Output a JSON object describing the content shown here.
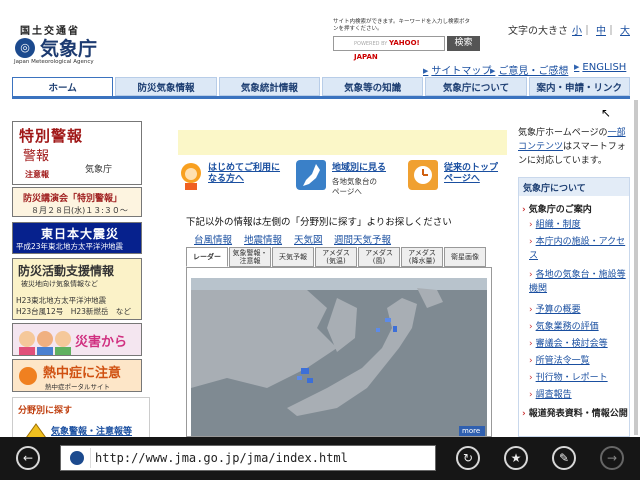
{
  "header": {
    "ministry": "国土交通省",
    "logo_text": "気象庁",
    "logo_en": "Japan Meteorological Agency",
    "search_help": "サイト内検索ができます。キーワードを入力し検索ボタンを押すください。",
    "search_powered": "POWERED BY",
    "search_brand": "YAHOO! JAPAN",
    "search_button": "検索",
    "font_size_label": "文字の大きさ",
    "font_small": "小",
    "font_medium": "中",
    "font_large": "大",
    "util_links": [
      "サイトマップ",
      "ご意見・ご感想",
      "ENGLISH"
    ]
  },
  "nav": [
    "ホーム",
    "防災気象情報",
    "気象統計情報",
    "気象等の知識",
    "気象庁について",
    "案内・申請・リンク"
  ],
  "left_banners": {
    "tokubetsu": {
      "t1": "特別警報",
      "t2": "警報",
      "t3": "注意報",
      "jma": "気象庁"
    },
    "lecture": {
      "t1": "防災講演会「特別警報」",
      "t2": "８月２８日(水)１３:３０～"
    },
    "quake": {
      "t1": "東日本大震災",
      "t2": "平成23年東北地方太平洋沖地震"
    },
    "support": {
      "t1": "防災活動支援情報",
      "t2": "被災地向け気象情報など",
      "t3": "H23東北地方太平洋沖地震",
      "t4": "H23台風12号　H23新燃岳　など"
    },
    "kids": {
      "t1": "災害から"
    },
    "heat": {
      "t1": "熱中症に注意",
      "t2": "熱中症ポータルサイト"
    }
  },
  "bunya": {
    "heading": "分野別に探す",
    "link": "気象警報・注意報等"
  },
  "quick_links": [
    {
      "title1": "はじめてご利用に",
      "title2": "なる方へ",
      "sub1": "",
      "sub2": ""
    },
    {
      "title1": "地域別に見る",
      "title2": "",
      "sub1": "各地気象台の",
      "sub2": "ページへ"
    },
    {
      "title1": "従来のトップ",
      "title2": "ページへ",
      "sub1": "",
      "sub2": ""
    }
  ],
  "intro": "下記以外の情報は左側の「分野別に探す」よりお探しください",
  "sub_links": [
    "台風情報",
    "地震情報",
    "天気図",
    "週間天気予報"
  ],
  "map_tabs": [
    {
      "l1": "レーダー",
      "l2": ""
    },
    {
      "l1": "気象警報・",
      "l2": "注意報"
    },
    {
      "l1": "天気予報",
      "l2": ""
    },
    {
      "l1": "アメダス",
      "l2": "(気温)"
    },
    {
      "l1": "アメダス",
      "l2": "(風)"
    },
    {
      "l1": "アメダス",
      "l2": "(降水量)"
    },
    {
      "l1": "衛星画像",
      "l2": ""
    }
  ],
  "map_more": "more",
  "right": {
    "intro_prefix": "気象庁ホームページの",
    "intro_link": "一部コンテンツ",
    "intro_suffix": "はスマートフォンに対応しています。",
    "panel_title": "気象庁について",
    "section1": "気象庁のご案内",
    "items": [
      "組織・制度",
      "本庁内の施設・アクセス",
      "各地の気象台・施設等機関",
      "予算の概要",
      "気象業務の評価",
      "審議会・検討会等",
      "所管法令一覧",
      "刊行物・レポート",
      "調査報告"
    ],
    "section2": "報道発表資料・情報公開"
  },
  "browser": {
    "url": "http://www.jma.go.jp/jma/index.html"
  }
}
